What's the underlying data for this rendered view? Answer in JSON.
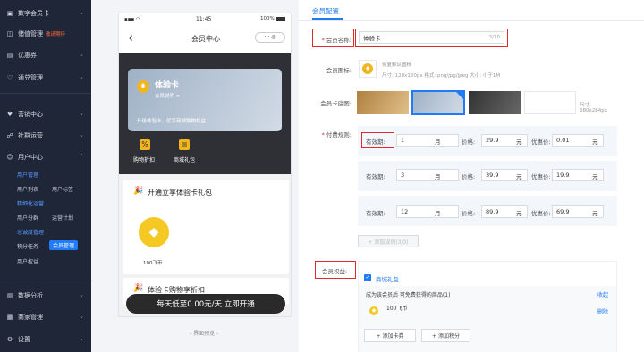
{
  "sidebar": {
    "items": [
      {
        "label": "数字会员卡",
        "icon": "card-icon"
      },
      {
        "label": "储值管理",
        "tag": "敬请期待",
        "icon": "wallet-icon"
      },
      {
        "label": "优惠券",
        "icon": "coupon-icon"
      },
      {
        "label": "通兑管理",
        "icon": "heart-icon"
      },
      {
        "label": "营销中心",
        "icon": "marketing-icon"
      },
      {
        "label": "社群运营",
        "icon": "community-icon"
      },
      {
        "label": "用户中心",
        "icon": "user-icon"
      },
      {
        "label": "数据分析",
        "icon": "chart-icon"
      },
      {
        "label": "商家管理",
        "icon": "store-icon"
      },
      {
        "label": "设置",
        "icon": "gear-icon"
      }
    ],
    "user_sub": {
      "user_mgmt": "用户管理",
      "user_list": "用户列表",
      "user_tags": "用户标签",
      "refined_ops": "精细化运营",
      "segmentation": "用户分群",
      "ops_plan": "运营计划",
      "loyalty_mgmt": "忠诚度管理",
      "points_task": "积分任务",
      "member_mgmt": "会员管理",
      "user_rights": "用户权益"
    }
  },
  "phone": {
    "time": "11:45",
    "battery": "100%",
    "title": "会员中心",
    "card_name": "体验卡",
    "card_desc": "会员说明 >",
    "card_upgrade": "升级体验卡，优享商城购物权益",
    "benefit1": "购物折扣",
    "benefit2": "商城礼包",
    "section1_title": "开通立享体验卡礼包",
    "gift_label": "100飞币",
    "section2_title": "体验卡购物享折扣",
    "cta": "每天低至0.00元/天 立即开通",
    "preview_label": "- 界面预览 -"
  },
  "config": {
    "tab": "会员配置",
    "name_label": "会员名称:",
    "name_value": "体验卡",
    "name_count": "3/10",
    "icon_label": "会员图标:",
    "icon_hint1": "恢复默认图标",
    "icon_hint2": "尺寸: 120x120px 格式: png/jpg/jpeg 大小: 小于1M",
    "bg_label": "会员卡底图:",
    "bg_size_label": "尺寸:",
    "bg_size_value": "680x284px",
    "pay_label": "付费规则:",
    "validity_label": "有效期:",
    "unit": "月",
    "price_label": "价格:",
    "price_unit": "元",
    "discount_label": "优惠价:",
    "tiers": [
      {
        "months": "1",
        "price": "29.9",
        "discount": "0.01"
      },
      {
        "months": "3",
        "price": "39.9",
        "discount": "19.9"
      },
      {
        "months": "12",
        "price": "89.9",
        "discount": "69.9"
      }
    ],
    "add_tier": "+ 添加规则(3/3)",
    "rights_label": "会员权益:",
    "rights_item": "商城礼包",
    "rights_desc": "成为该会员后 可免费获得的商品(1)",
    "collapse": "收起",
    "gift_item": "100飞币",
    "delete": "删除",
    "add_coupon": "+ 添加卡券",
    "add_points": "+ 添加积分"
  }
}
